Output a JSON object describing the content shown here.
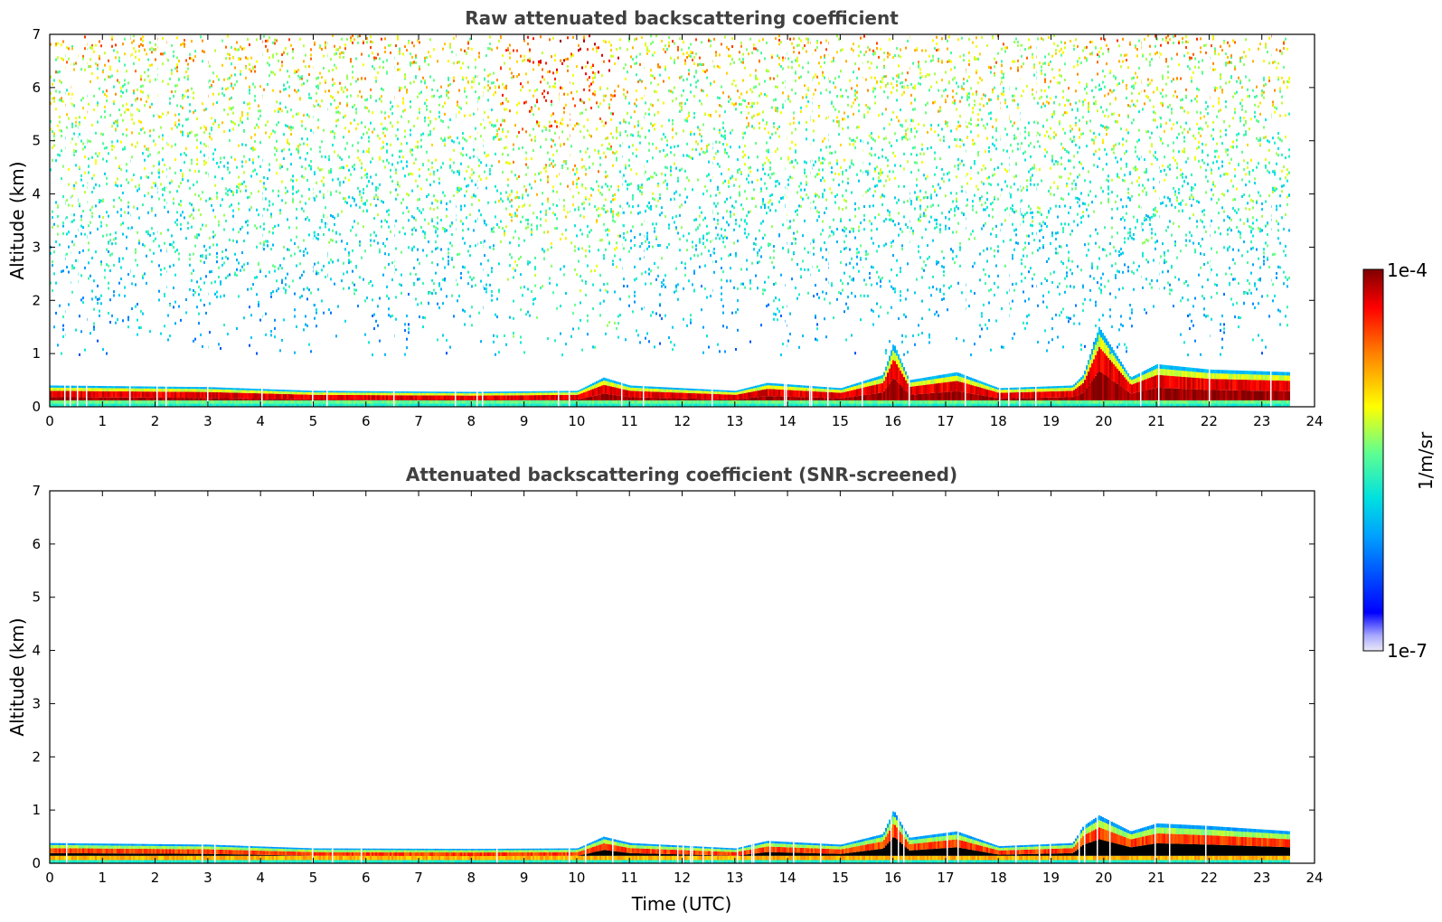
{
  "chart_data": [
    {
      "type": "heatmap",
      "title": "Raw attenuated backscattering coefficient",
      "xlabel": "",
      "ylabel": "Altitude (km)",
      "xlim": [
        0,
        24
      ],
      "ylim": [
        0,
        7
      ],
      "xticks": [
        "0",
        "1",
        "2",
        "3",
        "4",
        "5",
        "6",
        "7",
        "8",
        "9",
        "10",
        "11",
        "12",
        "13",
        "14",
        "15",
        "16",
        "17",
        "18",
        "19",
        "20",
        "21",
        "22",
        "23",
        "24"
      ],
      "yticks": [
        "0",
        "1",
        "2",
        "3",
        "4",
        "5",
        "6",
        "7"
      ],
      "data_end_hour": 23.55,
      "boundary_layer_top_km": [
        [
          0,
          0.4
        ],
        [
          3,
          0.37
        ],
        [
          5,
          0.3
        ],
        [
          8,
          0.28
        ],
        [
          10,
          0.3
        ],
        [
          10.5,
          0.55
        ],
        [
          11,
          0.4
        ],
        [
          13,
          0.3
        ],
        [
          13.6,
          0.45
        ],
        [
          15,
          0.35
        ],
        [
          15.8,
          0.6
        ],
        [
          16,
          1.2
        ],
        [
          16.3,
          0.5
        ],
        [
          17.2,
          0.65
        ],
        [
          18,
          0.35
        ],
        [
          19.4,
          0.4
        ],
        [
          19.6,
          0.6
        ],
        [
          19.9,
          1.5
        ],
        [
          20.5,
          0.55
        ],
        [
          21,
          0.8
        ],
        [
          22,
          0.7
        ],
        [
          23.55,
          0.65
        ]
      ],
      "signal_pattern": "noisy aerosol/molecular signal increasing with altitude, strong near-surface layer"
    },
    {
      "type": "heatmap",
      "title": "Attenuated backscattering coefficient (SNR-screened)",
      "xlabel": "Time (UTC)",
      "ylabel": "Altitude (km)",
      "xlim": [
        0,
        24
      ],
      "ylim": [
        0,
        7
      ],
      "xticks": [
        "0",
        "1",
        "2",
        "3",
        "4",
        "5",
        "6",
        "7",
        "8",
        "9",
        "10",
        "11",
        "12",
        "13",
        "14",
        "15",
        "16",
        "17",
        "18",
        "19",
        "20",
        "21",
        "22",
        "23",
        "24"
      ],
      "yticks": [
        "0",
        "1",
        "2",
        "3",
        "4",
        "5",
        "6",
        "7"
      ],
      "data_end_hour": 23.55,
      "boundary_layer_top_km": [
        [
          0,
          0.38
        ],
        [
          3,
          0.35
        ],
        [
          5,
          0.28
        ],
        [
          8,
          0.27
        ],
        [
          10,
          0.28
        ],
        [
          10.5,
          0.5
        ],
        [
          11,
          0.38
        ],
        [
          13,
          0.28
        ],
        [
          13.6,
          0.42
        ],
        [
          15,
          0.35
        ],
        [
          15.8,
          0.55
        ],
        [
          16,
          1.0
        ],
        [
          16.3,
          0.48
        ],
        [
          17.2,
          0.6
        ],
        [
          18,
          0.32
        ],
        [
          19.4,
          0.38
        ],
        [
          19.6,
          0.7
        ],
        [
          19.9,
          0.9
        ],
        [
          20.5,
          0.6
        ],
        [
          21,
          0.75
        ],
        [
          22,
          0.7
        ],
        [
          23.55,
          0.6
        ]
      ],
      "signal_pattern": "only near-surface boundary layer retained after SNR screening"
    }
  ],
  "colorbar": {
    "label": "1/m/sr",
    "max_label": "1e-4",
    "min_label": "1e-7",
    "colormap": "jet",
    "colors": [
      "#e6e6f5",
      "#0000ff",
      "#00a0ff",
      "#00ffff",
      "#80ff80",
      "#ffff00",
      "#ff8000",
      "#ff0000",
      "#800000"
    ]
  }
}
